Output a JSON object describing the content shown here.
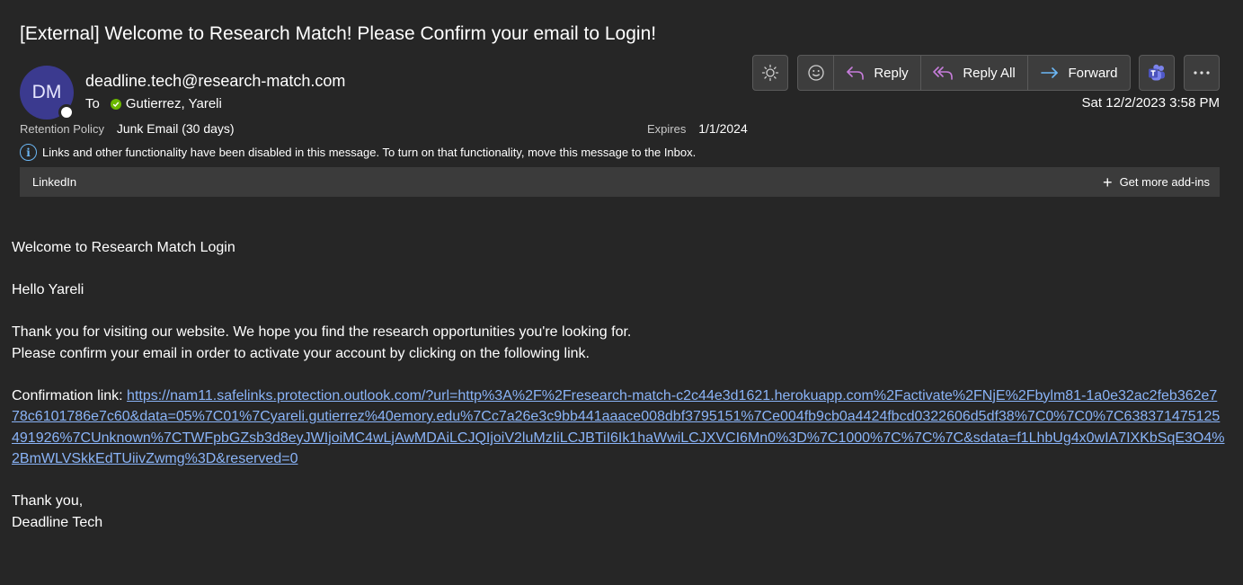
{
  "email": {
    "subject": "[External] Welcome to Research Match! Please Confirm your email to Login!",
    "avatar_initials": "DM",
    "sender": "deadline.tech@research-match.com",
    "to_label": "To",
    "to_name": "Gutierrez, Yareli",
    "retention_label": "Retention Policy",
    "retention_value": "Junk Email (30 days)",
    "expires_label": "Expires",
    "expires_value": "1/1/2024",
    "date": "Sat 12/2/2023 3:58 PM",
    "info_message": "Links and other functionality have been disabled in this message. To turn on that functionality, move this message to the Inbox."
  },
  "addins": {
    "item": "LinkedIn",
    "get_more": "Get more add-ins"
  },
  "toolbar": {
    "reply": "Reply",
    "reply_all": "Reply All",
    "forward": "Forward",
    "icons": [
      "brightness-icon",
      "emoji-icon",
      "reply-icon",
      "reply-all-icon",
      "forward-icon",
      "teams-icon",
      "more-icon"
    ]
  },
  "body": {
    "line1": "Welcome to Research Match Login",
    "line2": "Hello Yareli",
    "line3": "Thank you for visiting our website. We hope you find the research opportunities you're looking for.",
    "line4": "Please confirm your email in order to activate your account by clicking on the following link.",
    "link_label": "Confirmation link: ",
    "link_url": "https://nam11.safelinks.protection.outlook.com/?url=http%3A%2F%2Fresearch-match-c2c44e3d1621.herokuapp.com%2Factivate%2FNjE%2Fbylm81-1a0e32ac2feb362e778c6101786e7c60&data=05%7C01%7Cyareli.gutierrez%40emory.edu%7Cc7a26e3c9bb441aaace008dbf3795151%7Ce004fb9cb0a4424fbcd0322606d5df38%7C0%7C0%7C638371475125491926%7CUnknown%7CTWFpbGZsb3d8eyJWIjoiMC4wLjAwMDAiLCJQIjoiV2luMzIiLCJBTiI6Ik1haWwiLCJXVCI6Mn0%3D%7C1000%7C%7C%7C&sdata=f1LhbUg4x0wIA7IXKbSqE3O4%2BmWLVSkkEdTUiivZwmg%3D&reserved=0",
    "closing1": "Thank you,",
    "closing2": "Deadline Tech"
  },
  "colors": {
    "background": "#262626",
    "avatar": "#3b3a8f",
    "link": "#8ab4f8",
    "info": "#6cb8f6",
    "presence_check": "#6bb700"
  }
}
